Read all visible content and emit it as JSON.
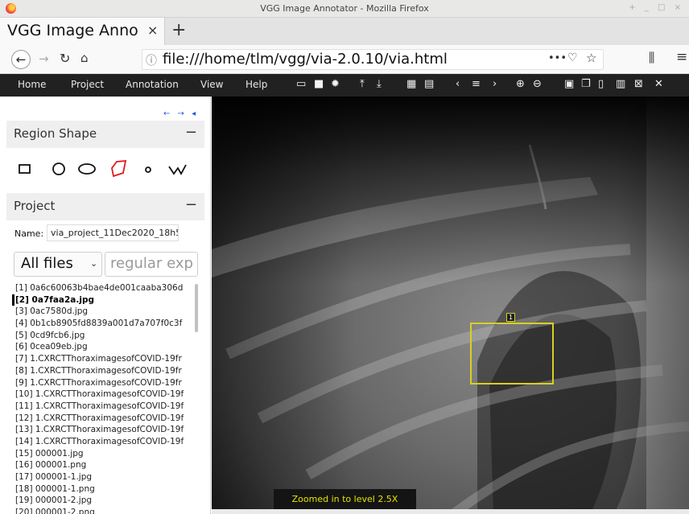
{
  "window": {
    "title": "VGG Image Annotator - Mozilla Firefox",
    "controls": "+ _ □ ×"
  },
  "browser": {
    "tab_label": "VGG Image Anno",
    "tab_close": "×",
    "new_tab": "+",
    "url": "file:///home/tlm/vgg/via-2.0.10/via.html",
    "icons": [
      "back-icon",
      "forward-icon",
      "reload-icon",
      "home-icon",
      "info-icon",
      "more-icon",
      "pocket-icon",
      "star-icon",
      "library-icon",
      "menu-icon"
    ]
  },
  "menubar": {
    "items": [
      "Home",
      "Project",
      "Annotation",
      "View",
      "Help"
    ],
    "tool_icons": [
      "open-folder-icon",
      "save-icon",
      "settings-icon",
      "upload-icon",
      "download-icon",
      "grid-icon",
      "comment-icon",
      "prev-icon",
      "list-icon",
      "next-icon",
      "zoom-in-icon",
      "zoom-out-icon",
      "select-all-icon",
      "copy-icon",
      "paste-icon",
      "paste-all-icon",
      "delete-selected-icon",
      "close-icon"
    ]
  },
  "sidebar": {
    "region_shape": {
      "title": "Region Shape",
      "collapse": "−",
      "shapes": [
        "rectangle",
        "circle",
        "ellipse",
        "polygon",
        "point",
        "polyline"
      ],
      "selected": "polygon"
    },
    "project": {
      "title": "Project",
      "collapse": "−",
      "name_label": "Name:",
      "name_value": "via_project_11Dec2020_18h5",
      "filter_value": "All files",
      "regex_placeholder": "regular exp",
      "files": [
        "[1] 0a6c60063b4bae4de001caaba306d",
        "[2] 0a7faa2a.jpg",
        "[3] 0ac7580d.jpg",
        "[4] 0b1cb8905fd8839a001d7a707f0c3f",
        "[5] 0cd9fcb6.jpg",
        "[6] 0cea09eb.jpg",
        "[7] 1.CXRCTThoraximagesofCOVID-19fr",
        "[8] 1.CXRCTThoraximagesofCOVID-19fr",
        "[9] 1.CXRCTThoraximagesofCOVID-19fr",
        "[10] 1.CXRCTThoraximagesofCOVID-19f",
        "[11] 1.CXRCTThoraximagesofCOVID-19f",
        "[12] 1.CXRCTThoraximagesofCOVID-19f",
        "[13] 1.CXRCTThoraximagesofCOVID-19f",
        "[14] 1.CXRCTThoraximagesofCOVID-19f",
        "[15] 000001.jpg",
        "[16] 000001.png",
        "[17] 000001-1.jpg",
        "[18] 000001-1.png",
        "[19] 000001-2.jpg",
        "[20] 000001-2.png"
      ],
      "active_index": 1
    }
  },
  "canvas": {
    "region_label": "1",
    "region_color": "#d9cf22",
    "zoom_message": "Zoomed in to level 2.5X"
  }
}
